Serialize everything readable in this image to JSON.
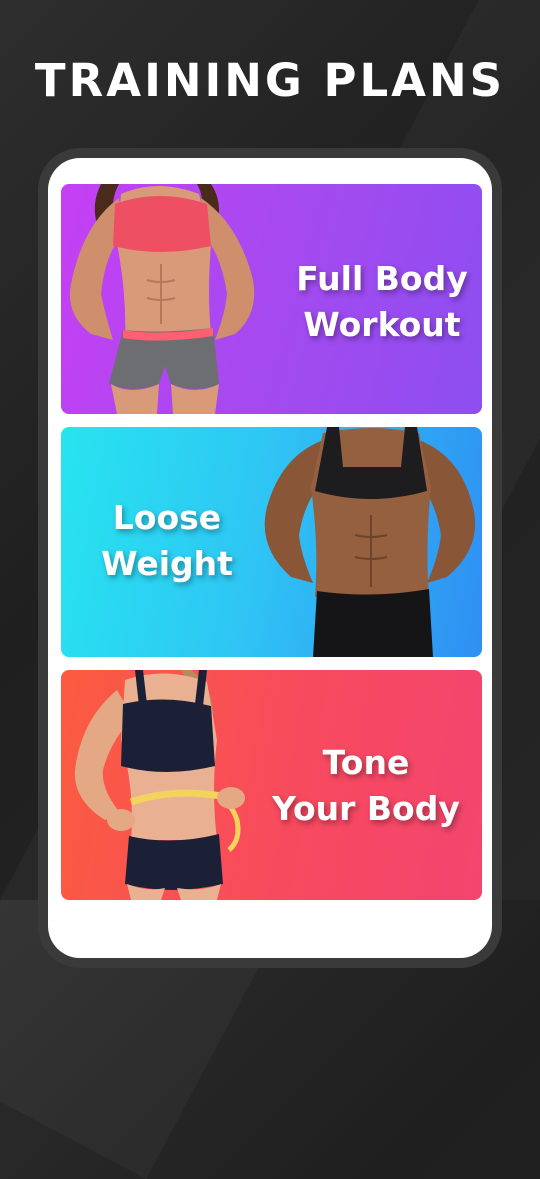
{
  "header": {
    "title": "TRAINING PLANS"
  },
  "plans": [
    {
      "title_line1": "Full Body",
      "title_line2": "Workout",
      "gradient": [
        "#c63ff4",
        "#8d4ef0"
      ],
      "image": "woman-pink-top-gray-shorts"
    },
    {
      "title_line1": "Loose",
      "title_line2": "Weight",
      "gradient": [
        "#27e4ef",
        "#2f8ff3"
      ],
      "image": "woman-black-sports-bra"
    },
    {
      "title_line1": "Tone",
      "title_line2": "Your Body",
      "gradient": [
        "#fb5c40",
        "#f3456f"
      ],
      "image": "woman-measuring-waist-tape"
    }
  ]
}
